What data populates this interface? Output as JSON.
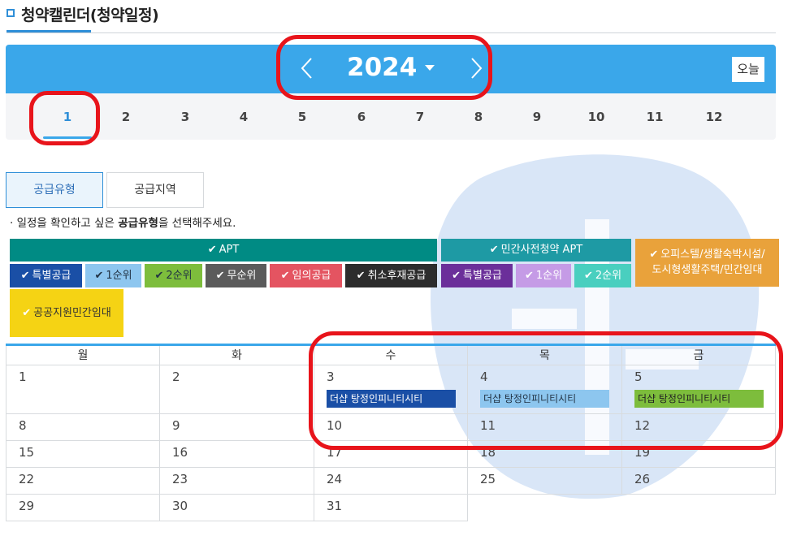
{
  "header": {
    "title": "청약캘린더(청약일정)"
  },
  "year_nav": {
    "year": "2024",
    "today_label": "오늘"
  },
  "months": [
    "1",
    "2",
    "3",
    "4",
    "5",
    "6",
    "7",
    "8",
    "9",
    "10",
    "11",
    "12"
  ],
  "selected_month": "1",
  "tabs": {
    "type_label": "공급유형",
    "region_label": "공급지역"
  },
  "notice": {
    "prefix": "· 일정을 확인하고 싶은 ",
    "bold": "공급유형",
    "suffix": "을 선택해주세요."
  },
  "filters": {
    "apt": {
      "label": "APT",
      "color": "#008b84",
      "items": [
        {
          "label": "특별공급",
          "color": "#1a4fa6"
        },
        {
          "label": "1순위",
          "color": "#8dc6ef"
        },
        {
          "label": "2순위",
          "color": "#7dbd3c"
        },
        {
          "label": "무순위",
          "color": "#5b5b5b"
        },
        {
          "label": "임의공급",
          "color": "#e45461"
        },
        {
          "label": "취소후재공급",
          "color": "#2c2c2c"
        }
      ]
    },
    "presale": {
      "label": "민간사전청약 APT",
      "color": "#1e9aa4",
      "items": [
        {
          "label": "특별공급",
          "color": "#6b2f9a"
        },
        {
          "label": "1순위",
          "color": "#c59be6"
        },
        {
          "label": "2순위",
          "color": "#49cfbf"
        }
      ]
    },
    "officetel": {
      "line1": "오피스텔/생활숙박시설/",
      "line2": "도시형생활주택/민간임대",
      "color": "#e9a23b"
    },
    "public_rental": {
      "label": "공공지원민간임대",
      "color": "#f5d314"
    }
  },
  "calendar": {
    "weekdays": [
      "월",
      "화",
      "수",
      "목",
      "금"
    ],
    "weeks": [
      [
        "1",
        "2",
        "3",
        "4",
        "5"
      ],
      [
        "8",
        "9",
        "10",
        "11",
        "12"
      ],
      [
        "15",
        "16",
        "17",
        "18",
        "19"
      ],
      [
        "22",
        "23",
        "24",
        "25",
        "26"
      ],
      [
        "29",
        "30",
        "31",
        "",
        ""
      ]
    ],
    "events": [
      {
        "day": "3",
        "label": "더샵 탕정인피니티시티",
        "color": "#1a4fa6"
      },
      {
        "day": "4",
        "label": "더샵 탕정인피니티시티",
        "color": "#8dc6ef"
      },
      {
        "day": "5",
        "label": "더샵 탕정인피니티시티",
        "color": "#7dbd3c"
      }
    ]
  },
  "colors": {
    "accent": "#3aa7ea",
    "highlight_ring": "#e8141b"
  },
  "icons": {
    "prev": "chevron-left-icon",
    "next": "chevron-right-icon",
    "dropdown": "caret-down-icon",
    "check": "check-icon"
  }
}
